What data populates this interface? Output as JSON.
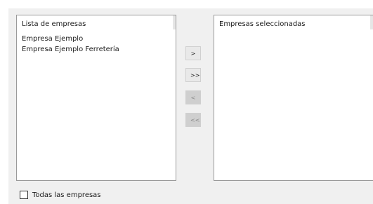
{
  "available_list": {
    "header": "Lista de empresas",
    "items": [
      "Empresa Ejemplo",
      "Empresa Ejemplo Ferretería"
    ]
  },
  "selected_list": {
    "header": "Empresas seleccionadas",
    "items": []
  },
  "transfer_buttons": {
    "move_selected": ">",
    "move_all": ">>",
    "remove_selected": "<",
    "remove_all": "<<"
  },
  "all_companies_checkbox": {
    "label": "Todas las empresas",
    "checked": false
  }
}
